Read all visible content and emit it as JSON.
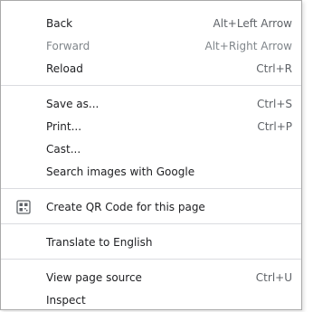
{
  "menu": {
    "items": [
      {
        "label": "Back",
        "shortcut": "Alt+Left Arrow"
      },
      {
        "label": "Forward",
        "shortcut": "Alt+Right Arrow"
      },
      {
        "label": "Reload",
        "shortcut": "Ctrl+R"
      },
      {
        "label": "Save as...",
        "shortcut": "Ctrl+S"
      },
      {
        "label": "Print...",
        "shortcut": "Ctrl+P"
      },
      {
        "label": "Cast..."
      },
      {
        "label": "Search images with Google"
      },
      {
        "label": "Create QR Code for this page",
        "icon": "qr-code-icon"
      },
      {
        "label": "Translate to English"
      },
      {
        "label": "View page source",
        "shortcut": "Ctrl+U"
      },
      {
        "label": "Inspect"
      }
    ],
    "disabled_items": [
      "Forward"
    ]
  },
  "colors": {
    "text": "#202124",
    "disabled_text": "#80868b",
    "separator": "#dadce0",
    "border": "#a9a9a9",
    "icon": "#5f6368"
  }
}
